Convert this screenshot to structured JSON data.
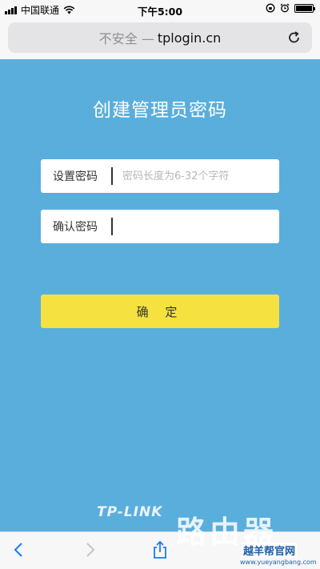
{
  "status_bar": {
    "carrier": "中国联通",
    "time": "下午5:00"
  },
  "address_bar": {
    "security_text": "不安全 —",
    "host": "tplogin.cn"
  },
  "page": {
    "title": "创建管理员密码",
    "set_password": {
      "label": "设置密码",
      "placeholder": "密码长度为6-32个字符",
      "value": ""
    },
    "confirm_password": {
      "label": "确认密码",
      "placeholder": "",
      "value": ""
    },
    "confirm_button_label": "确 定",
    "brand_logo": "TP-LINK"
  },
  "watermark": {
    "big_text": "路由器",
    "site_text": "越羊帮官网",
    "site_url": "www.yueyangbang.com"
  },
  "colors": {
    "page_background": "#5aaedc",
    "confirm_button": "#f5e140"
  },
  "icons": {
    "reload": "reload-icon",
    "back": "back-arrow-icon",
    "forward": "forward-arrow-icon",
    "share": "share-icon"
  }
}
